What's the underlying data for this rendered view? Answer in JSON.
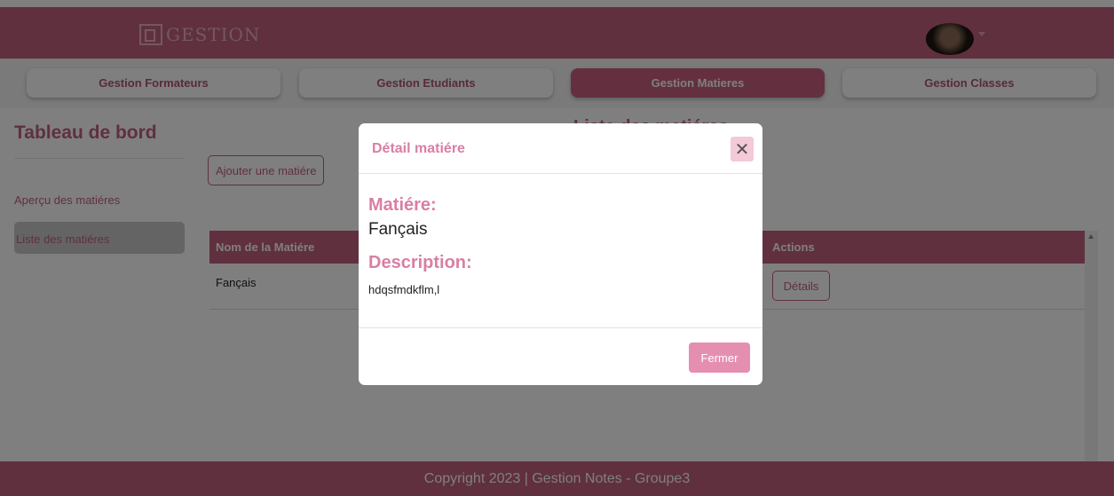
{
  "brand": {
    "name": "GESTION",
    "icon": "logo-icon"
  },
  "navbar": {
    "avatar": "user-avatar",
    "caret_icon": "chevron-down-icon"
  },
  "tabs": [
    {
      "label": "Gestion Formateurs",
      "active": false
    },
    {
      "label": "Gestion Etudiants",
      "active": false
    },
    {
      "label": "Gestion Matieres",
      "active": true
    },
    {
      "label": "Gestion Classes",
      "active": false
    }
  ],
  "sidebar": {
    "title": "Tableau de bord",
    "items": [
      {
        "label": "Aperçu des matiéres",
        "active": false
      },
      {
        "label": "Liste des matiéres",
        "active": true
      }
    ]
  },
  "main": {
    "title": "Liste des matiéres",
    "add_button": "Ajouter une matiére",
    "table": {
      "columns": [
        "Nom de la Matiére",
        "Actions"
      ],
      "rows": [
        {
          "name": "Fançais",
          "action": "Détails"
        }
      ]
    }
  },
  "modal": {
    "title": "Détail matiére",
    "close_icon": "close-icon",
    "subject_label": "Matiére:",
    "subject_value": "Fançais",
    "description_label": "Description:",
    "description_value": "hdqsfmdkflm,l",
    "close_button": "Fermer"
  },
  "footer": {
    "text": "Copyright 2023 | Gestion Notes - Groupe3"
  },
  "colors": {
    "primary": "#c0607e",
    "accent": "#d97fa4",
    "button_light": "#e58fb0",
    "close_bg": "#f4c9d8"
  }
}
